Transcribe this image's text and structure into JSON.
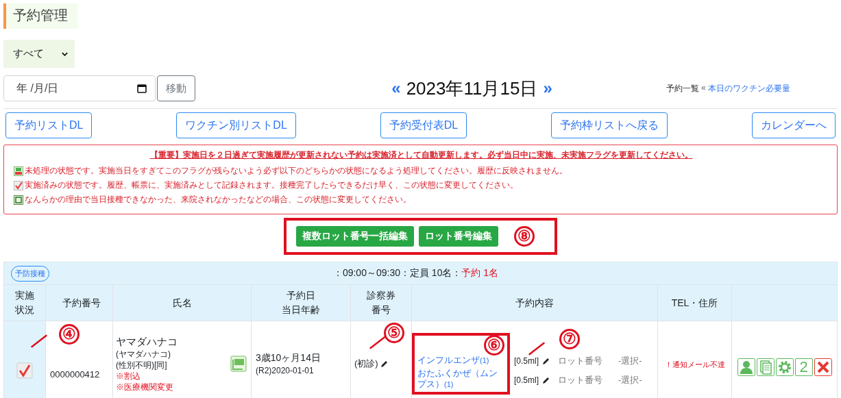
{
  "page_title": "予約管理",
  "filter": {
    "value": "すべて"
  },
  "date_field": {
    "placeholder": "年 /月/日"
  },
  "move_button": "移動",
  "date_nav": {
    "prev": "«",
    "date": "2023年11月15日",
    "next": "»"
  },
  "breadcrumb": {
    "current": "予約一覧",
    "separator": "«",
    "link": "本日のワクチン必要量"
  },
  "buttons": [
    "予約リストDL",
    "ワクチン別リストDL",
    "予約受付表DL",
    "予約枠リストへ戻る",
    "カレンダーへ"
  ],
  "notice": {
    "headline": "【重要】実施日を２日過ぎて実施履歴が更新されない予約は実施済として自動更新します。必ず当日中に実施、未実施フラグを更新してください。",
    "items": [
      {
        "kind": "new",
        "text": "未処理の状態です。実施当日をすぎてこのフラグが残らないよう必ず以下のどちらかの状態になるよう処理してください。履歴に反映されません。"
      },
      {
        "kind": "done",
        "text": "実施済みの状態です。履歴、帳票に、実施済みとして記録されます。接種完了したらできるだけ早く、この状態に変更してください。"
      },
      {
        "kind": "not_done",
        "text": "なんらかの理由で当日接種できなかった、来院されなかったなどの場合、この状態に変更してください。"
      }
    ]
  },
  "lot_buttons": [
    "複数ロット番号一括編集",
    "ロット番号編集"
  ],
  "lot_callout": "⑧",
  "slot": {
    "badge": "予防接種",
    "time": "：09:00～09:30：定員 10名：",
    "reserved": "予約 1名"
  },
  "columns": [
    [
      "実施",
      "状況"
    ],
    [
      "予約番号"
    ],
    [
      "氏名"
    ],
    [
      "予約日",
      "当日年齢"
    ],
    [
      "診察券",
      "番号"
    ],
    [
      "予約内容"
    ],
    [
      "TEL・住所"
    ]
  ],
  "rows": [
    {
      "done": true,
      "done_callout": "④",
      "reservation_no": "0000000412",
      "name": "ヤマダハナコ",
      "name_lines": [
        "(ヤマダハナコ)",
        "(性別不明)[同]"
      ],
      "flags": [
        "※割込",
        "※医療機関変更"
      ],
      "age": "3歳10ヶ月14日",
      "birth": "(R2)2020-01-01",
      "ticket": "(初診)",
      "ticket_callout": "⑤",
      "vaccine_callout": "⑥",
      "dose_callout": "⑦",
      "vaccines": [
        {
          "name": "インフルエンザ",
          "count": "(1)",
          "dose": "[0.5ml]",
          "lot_label": "ロット番号",
          "lot_value": "-選択-"
        },
        {
          "name": "おたふくかぜ（ムンプス）",
          "count": "(1)",
          "dose": "[0.5ml]",
          "lot_label": "ロット番号",
          "lot_value": "-選択-"
        }
      ],
      "contact": "！通知メール不達",
      "actions": [
        {
          "kind": "person"
        },
        {
          "kind": "document"
        },
        {
          "kind": "settings"
        },
        {
          "kind": "count",
          "label": "2"
        },
        {
          "kind": "delete"
        }
      ]
    }
  ]
}
